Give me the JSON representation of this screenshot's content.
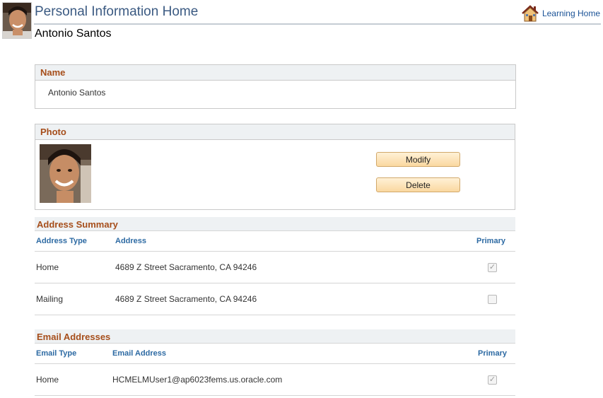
{
  "header": {
    "title": "Personal Information Home",
    "user_name": "Antonio Santos",
    "home_link": "Learning Home"
  },
  "name_section": {
    "title": "Name",
    "value": "Antonio Santos"
  },
  "photo_section": {
    "title": "Photo",
    "modify_label": "Modify",
    "delete_label": "Delete"
  },
  "address_summary": {
    "title": "Address Summary",
    "columns": [
      "Address Type",
      "Address",
      "Primary"
    ],
    "rows": [
      {
        "type": "Home",
        "address": "4689 Z Street Sacramento, CA 94246",
        "primary": true
      },
      {
        "type": "Mailing",
        "address": "4689 Z Street Sacramento, CA 94246",
        "primary": false
      }
    ]
  },
  "email_addresses": {
    "title": "Email Addresses",
    "columns": [
      "Email Type",
      "Email Address",
      "Primary"
    ],
    "rows": [
      {
        "type": "Home",
        "email": "HCMELMUser1@ap6023fems.us.oracle.com",
        "primary": true
      }
    ]
  },
  "icons": {
    "home": "home-icon",
    "check": "checkmark-icon"
  },
  "colors": {
    "title_blue": "#3b5a82",
    "section_title": "#a64e1b",
    "column_header": "#2d6aa3",
    "button_fill": "#fad8a0"
  }
}
